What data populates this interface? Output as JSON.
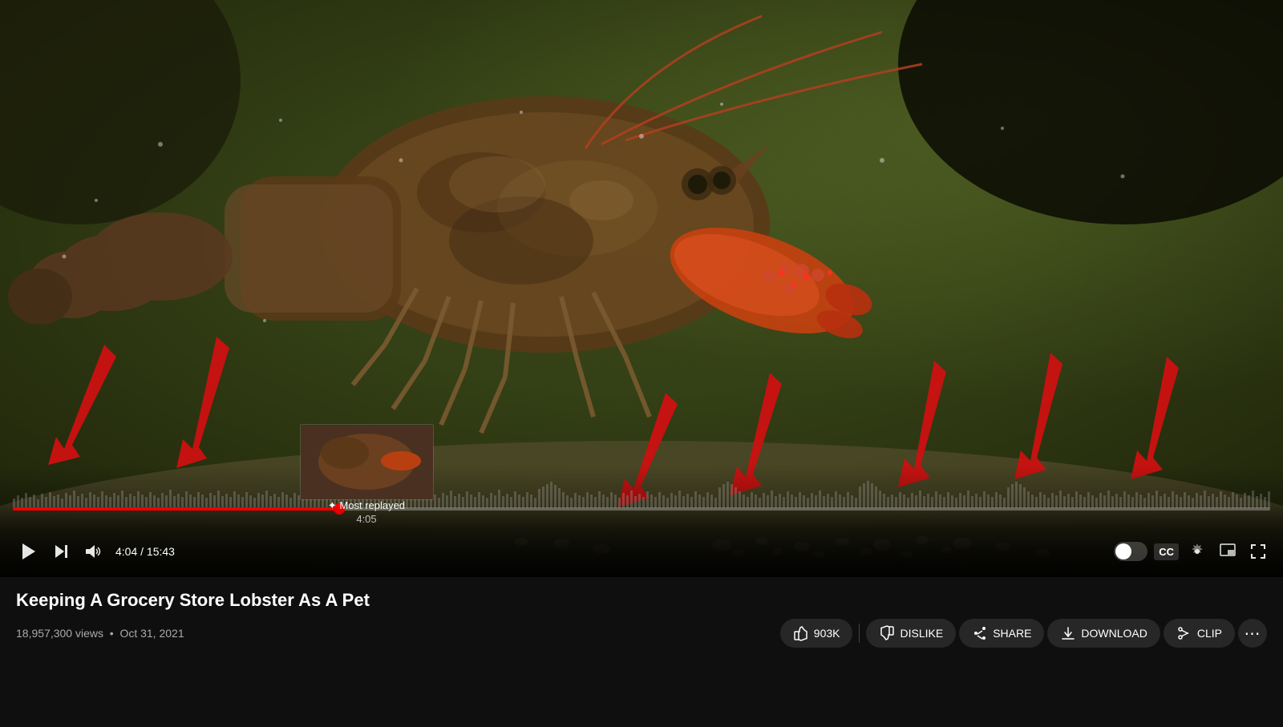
{
  "video": {
    "title": "Keeping A Grocery Store Lobster As A Pet",
    "views": "18,957,300 views",
    "date": "Oct 31, 2021",
    "current_time": "4:04",
    "total_time": "15:43",
    "progress_percent": 26.4,
    "tooltip": {
      "label_icon": "✦",
      "label_text": "Most replayed",
      "timestamp": "4:05"
    }
  },
  "controls": {
    "play_label": "Play",
    "next_label": "Next",
    "volume_label": "Volume",
    "time_display": "4:04 / 15:43",
    "cc_label": "CC",
    "settings_label": "Settings",
    "fullscreen_label": "Fullscreen"
  },
  "actions": {
    "like_label": "903K",
    "dislike_label": "DISLIKE",
    "share_label": "SHARE",
    "download_label": "DOWNLOAD",
    "clip_label": "CLIP",
    "more_label": "..."
  },
  "colors": {
    "progress_red": "#ff0000",
    "background": "#0f0f0f",
    "control_bg": "rgba(0,0,0,0.85)",
    "arrow_red": "#cc0000"
  }
}
